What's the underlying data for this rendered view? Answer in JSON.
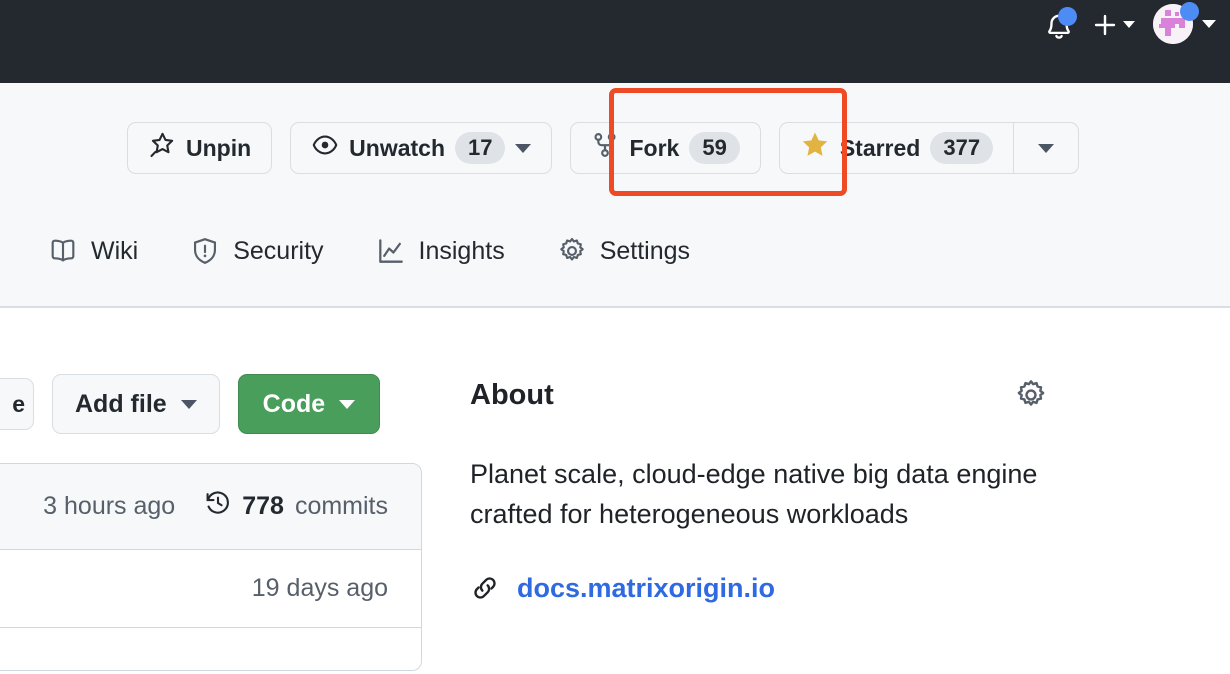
{
  "topbar": {
    "background": "#24292f",
    "notification_dot_color": "#4d8bf5",
    "items": [
      {
        "name": "notifications",
        "icon": "bell-icon",
        "has_dot": true
      },
      {
        "name": "create-new",
        "icon": "plus-icon",
        "has_caret": true
      },
      {
        "name": "user-account",
        "icon": "avatar",
        "has_dot": true,
        "has_caret": true
      }
    ]
  },
  "repo_actions": {
    "unpin": {
      "label": "Unpin",
      "icon": "pin-slash-icon"
    },
    "unwatch": {
      "label": "Unwatch",
      "count": "17",
      "icon": "eye-icon",
      "has_caret": true
    },
    "fork": {
      "label": "Fork",
      "count": "59",
      "icon": "repo-forked-icon",
      "highlighted": true,
      "highlight_color": "#ee4a26"
    },
    "starred": {
      "label": "Starred",
      "count": "377",
      "icon": "star-filled-icon",
      "star_color": "#e3b341",
      "has_caret": true
    }
  },
  "nav_tabs": [
    {
      "label": "Wiki",
      "icon": "book-icon"
    },
    {
      "label": "Security",
      "icon": "shield-alert-icon"
    },
    {
      "label": "Insights",
      "icon": "graph-icon"
    },
    {
      "label": "Settings",
      "icon": "gear-icon"
    }
  ],
  "file_actions": {
    "go_to_file": {
      "label": "e",
      "full_label": "Go to file"
    },
    "add_file": {
      "label": "Add file",
      "has_caret": true
    },
    "code": {
      "label": "Code",
      "has_caret": true,
      "color": "#4a9e5c"
    }
  },
  "file_box": {
    "latest_commit_time": "3 hours ago",
    "commits_count": "778",
    "commits_label": "commits",
    "commits_icon": "history-icon",
    "rows": [
      {
        "time": "19 days ago"
      }
    ]
  },
  "about": {
    "title": "About",
    "settings_icon": "gear-icon",
    "description": "Planet scale, cloud-edge native big data engine crafted for heterogeneous workloads",
    "link": {
      "label": "docs.matrixorigin.io",
      "icon": "link-icon",
      "color": "#2f6ae0"
    }
  }
}
